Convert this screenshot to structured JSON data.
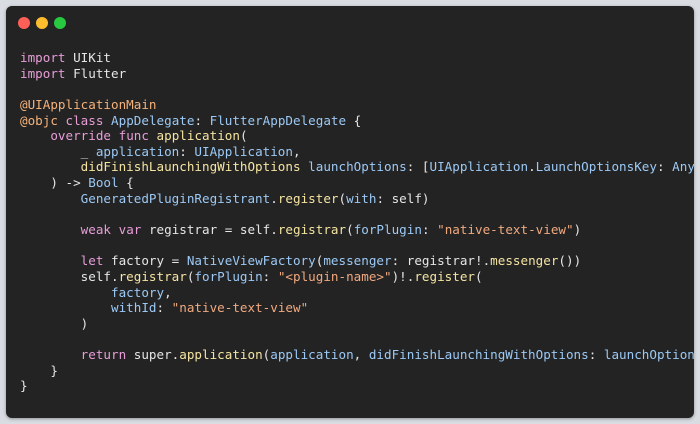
{
  "window": {
    "traffic_lights": [
      {
        "name": "close",
        "color": "#fe5f57"
      },
      {
        "name": "minimize",
        "color": "#febc2e"
      },
      {
        "name": "zoom",
        "color": "#28c840"
      }
    ]
  },
  "code": {
    "language": "swift",
    "colors": {
      "background": "#232323",
      "keyword": "#e79ed8",
      "attribute": "#f4b27b",
      "type": "#9cc9f5",
      "string": "#f0a980",
      "function": "#f5e4a2",
      "plain": "#e6e6e6"
    },
    "lines": [
      [
        [
          "kw",
          "import"
        ],
        [
          "plain",
          " UIKit"
        ]
      ],
      [
        [
          "kw",
          "import"
        ],
        [
          "plain",
          " Flutter"
        ]
      ],
      [],
      [
        [
          "at",
          "@UIApplicationMain"
        ]
      ],
      [
        [
          "at",
          "@objc"
        ],
        [
          "plain",
          " "
        ],
        [
          "kw",
          "class"
        ],
        [
          "plain",
          " "
        ],
        [
          "type",
          "AppDelegate"
        ],
        [
          "plain",
          ": "
        ],
        [
          "type",
          "FlutterAppDelegate"
        ],
        [
          "plain",
          " {"
        ]
      ],
      [
        [
          "plain",
          "    "
        ],
        [
          "kw",
          "override"
        ],
        [
          "plain",
          " "
        ],
        [
          "kw",
          "func"
        ],
        [
          "plain",
          " "
        ],
        [
          "fn",
          "application"
        ],
        [
          "plain",
          "("
        ]
      ],
      [
        [
          "plain",
          "        _ "
        ],
        [
          "type",
          "application"
        ],
        [
          "plain",
          ": "
        ],
        [
          "type",
          "UIApplication"
        ],
        [
          "plain",
          ","
        ]
      ],
      [
        [
          "plain",
          "        "
        ],
        [
          "fn",
          "didFinishLaunchingWithOptions"
        ],
        [
          "plain",
          " "
        ],
        [
          "type",
          "launchOptions"
        ],
        [
          "plain",
          ": ["
        ],
        [
          "type",
          "UIApplication"
        ],
        [
          "plain",
          "."
        ],
        [
          "type",
          "LaunchOptionsKey"
        ],
        [
          "plain",
          ": "
        ],
        [
          "type",
          "Any"
        ],
        [
          "plain",
          "]?"
        ]
      ],
      [
        [
          "plain",
          "    ) -> "
        ],
        [
          "type",
          "Bool"
        ],
        [
          "plain",
          " {"
        ]
      ],
      [
        [
          "plain",
          "        "
        ],
        [
          "type",
          "GeneratedPluginRegistrant"
        ],
        [
          "plain",
          "."
        ],
        [
          "fn",
          "register"
        ],
        [
          "plain",
          "("
        ],
        [
          "type",
          "with"
        ],
        [
          "plain",
          ": self)"
        ]
      ],
      [],
      [
        [
          "plain",
          "        "
        ],
        [
          "kw",
          "weak"
        ],
        [
          "plain",
          " "
        ],
        [
          "kw",
          "var"
        ],
        [
          "plain",
          " registrar = self."
        ],
        [
          "fn",
          "registrar"
        ],
        [
          "plain",
          "("
        ],
        [
          "type",
          "forPlugin"
        ],
        [
          "plain",
          ": "
        ],
        [
          "str",
          "\"native-text-view\""
        ],
        [
          "plain",
          ")"
        ]
      ],
      [],
      [
        [
          "plain",
          "        "
        ],
        [
          "kw",
          "let"
        ],
        [
          "plain",
          " factory = "
        ],
        [
          "type",
          "NativeViewFactory"
        ],
        [
          "plain",
          "("
        ],
        [
          "type",
          "messenger"
        ],
        [
          "plain",
          ": registrar!."
        ],
        [
          "fn",
          "messenger"
        ],
        [
          "plain",
          "())"
        ]
      ],
      [
        [
          "plain",
          "        self."
        ],
        [
          "fn",
          "registrar"
        ],
        [
          "plain",
          "("
        ],
        [
          "type",
          "forPlugin"
        ],
        [
          "plain",
          ": "
        ],
        [
          "str",
          "\"<plugin-name>\""
        ],
        [
          "plain",
          ")!."
        ],
        [
          "fn",
          "register"
        ],
        [
          "plain",
          "("
        ]
      ],
      [
        [
          "plain",
          "            "
        ],
        [
          "type",
          "factory"
        ],
        [
          "plain",
          ","
        ]
      ],
      [
        [
          "plain",
          "            "
        ],
        [
          "type",
          "withId"
        ],
        [
          "plain",
          ": "
        ],
        [
          "str",
          "\"native-text-view\""
        ]
      ],
      [
        [
          "plain",
          "        )"
        ]
      ],
      [],
      [
        [
          "plain",
          "        "
        ],
        [
          "kw",
          "return"
        ],
        [
          "plain",
          " super."
        ],
        [
          "fn",
          "application"
        ],
        [
          "plain",
          "("
        ],
        [
          "type",
          "application"
        ],
        [
          "plain",
          ", "
        ],
        [
          "type",
          "didFinishLaunchingWithOptions"
        ],
        [
          "plain",
          ": "
        ],
        [
          "type",
          "launchOptions"
        ],
        [
          "plain",
          ")"
        ]
      ],
      [
        [
          "plain",
          "    }"
        ]
      ],
      [
        [
          "plain",
          "}"
        ]
      ]
    ]
  }
}
